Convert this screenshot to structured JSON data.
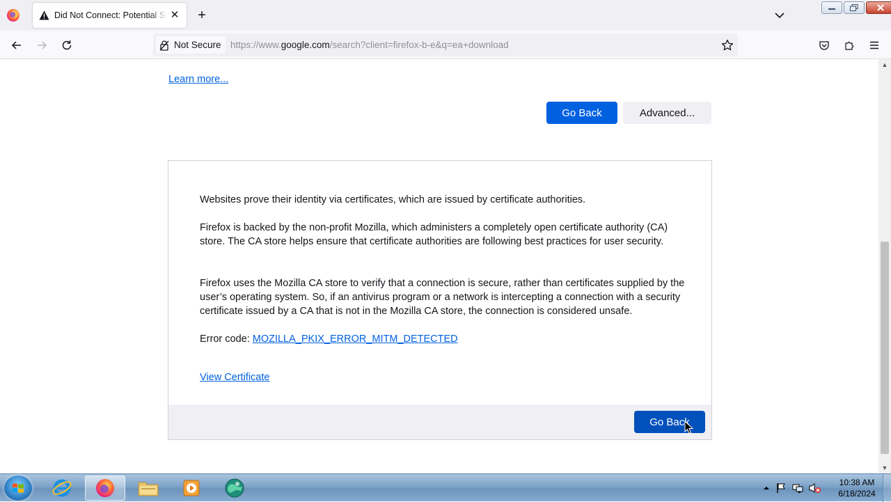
{
  "tab": {
    "title": "Did Not Connect: Potential Security Issue",
    "close_glyph": "✕"
  },
  "toolbar": {
    "new_tab_glyph": "+"
  },
  "urlbar": {
    "security_label": "Not Secure",
    "url_prefix": "https://www.",
    "url_host": "google.com",
    "url_path": "/search?client=firefox-b-e&q=ea+download"
  },
  "page": {
    "learn_more": "Learn more...",
    "go_back_label": "Go Back",
    "advanced_label": "Advanced...",
    "paragraphs": [
      "Websites prove their identity via certificates, which are issued by certificate authorities.",
      "Firefox is backed by the non-profit Mozilla, which administers a completely open certificate authority (CA) store. The CA store helps ensure that certificate authorities are following best practices for user security.",
      "Firefox uses the Mozilla CA store to verify that a connection is secure, rather than certificates supplied by the user’s operating system. So, if an antivirus program or a network is intercepting a connection with a security certificate issued by a CA that is not in the Mozilla CA store, the connection is considered unsafe."
    ],
    "error_code_label": "Error code: ",
    "error_code": "MOZILLA_PKIX_ERROR_MITM_DETECTED",
    "view_certificate": "View Certificate",
    "footer_go_back": "Go Back"
  },
  "taskbar": {
    "clock_time": "10:38 AM",
    "clock_date": "6/18/2024"
  },
  "colors": {
    "accent": "#0061e0",
    "footer_button": "#0250bb"
  }
}
